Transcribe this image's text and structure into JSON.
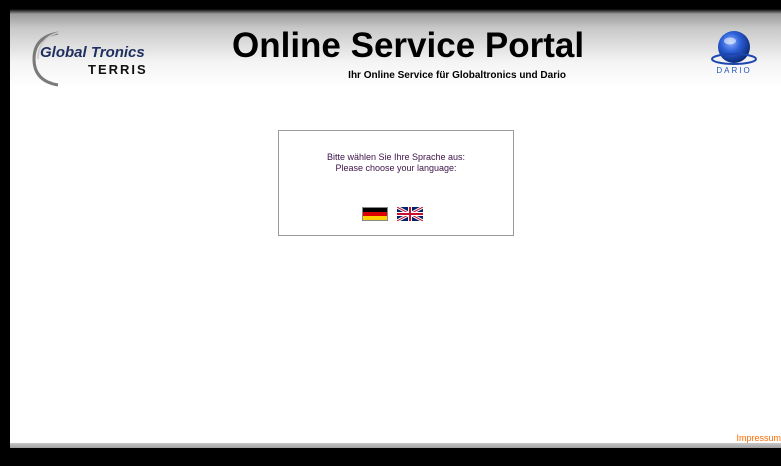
{
  "header": {
    "brand_left": {
      "line1": "Global Tronics",
      "line2": "TERRIS"
    },
    "title": "Online Service Portal",
    "subtitle": "Ihr Online Service für Globaltronics und Dario",
    "brand_right": "DARIO"
  },
  "language_box": {
    "prompt_de": "Bitte wählen Sie Ihre Sprache aus:",
    "prompt_en": "Please choose your language:",
    "flags": [
      {
        "icon": "german-flag-icon",
        "colors": [
          "#000000",
          "#dd0000",
          "#ffce00"
        ]
      },
      {
        "icon": "uk-flag-icon",
        "colors": [
          "#012169",
          "#ffffff",
          "#c8102e"
        ]
      }
    ]
  },
  "footer": {
    "link": "Impressum",
    "link_color": "#ff6a00"
  },
  "colors": {
    "prompt_text": "#3c1248",
    "dario_blue": "#2a56b7"
  }
}
